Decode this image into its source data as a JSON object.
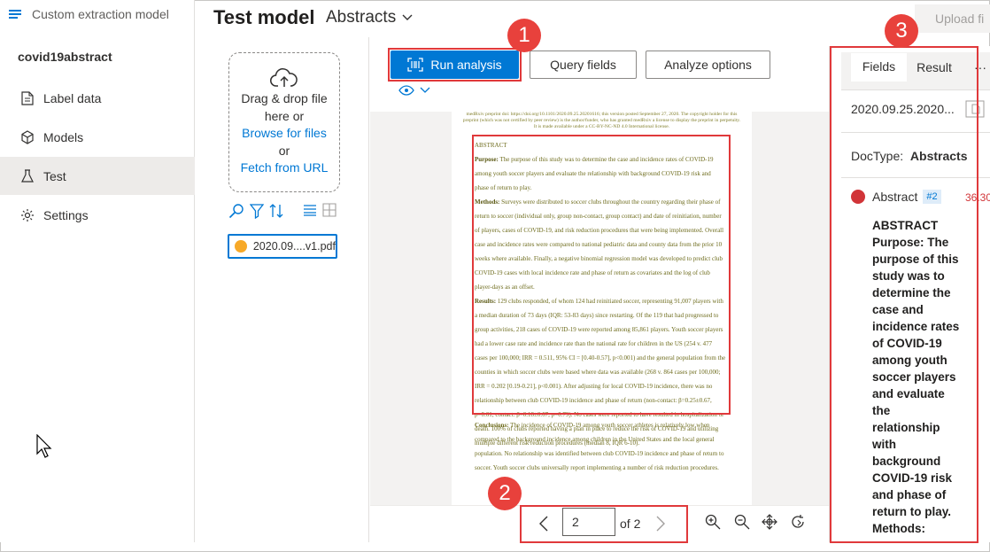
{
  "nav": {
    "app_title": "Custom extraction model",
    "project_name": "covid19abstract",
    "items": [
      {
        "label": "Label data",
        "icon": "document-icon"
      },
      {
        "label": "Models",
        "icon": "cube-icon"
      },
      {
        "label": "Test",
        "icon": "flask-icon"
      },
      {
        "label": "Settings",
        "icon": "gear-icon"
      }
    ]
  },
  "header": {
    "title": "Test model",
    "doc_type": "Abstracts",
    "upload_label": "Upload fi"
  },
  "files": {
    "drop_line1": "Drag & drop file",
    "drop_line2": "here or",
    "browse_link": "Browse for files",
    "or_text": "or",
    "fetch_link": "Fetch from URL",
    "file_name": "2020.09....v1.pdf"
  },
  "toolbar": {
    "run_label": "Run analysis",
    "query_label": "Query fields",
    "analyze_label": "Analyze options"
  },
  "document": {
    "header_line1": "medRxiv preprint doi: https://doi.org/10.1101/2020.09.25.20201616; this version posted September 27, 2020. The copyright holder for this",
    "header_line2": "preprint (which was not certified by peer review) is the author/funder, who has granted medRxiv a license to display the preprint in perpetuity.",
    "header_line3": "It is made available under a CC-BY-NC-ND 4.0 International license.",
    "heading": "ABSTRACT",
    "purpose_label": "Purpose:",
    "purpose_text": "The purpose of this study was to determine the case and incidence rates of COVID-19 among youth soccer players and evaluate the relationship with background COVID-19 risk and phase of return to play.",
    "methods_label": "Methods:",
    "methods_text": "Surveys were distributed to soccer clubs throughout the country regarding their phase of return to soccer (individual only, group non-contact, group contact) and date of reinitiation, number of players, cases of COVID-19, and risk reduction procedures that were being implemented. Overall case and incidence rates were compared to national pediatric data and county data from the prior 10 weeks where available. Finally, a negative binomial regression model was developed to predict club COVID-19 cases with local incidence rate and phase of return as covariates and the log of club player-days as an offset.",
    "results_label": "Results:",
    "results_text": "129 clubs responded, of whom 124 had reinitiated soccer, representing 91,007 players with a median duration of 73 days (IQR: 53-83 days) since restarting. Of the 119 that had progressed to group activities, 218 cases of COVID-19 were reported among 85,861 players. Youth soccer players had a lower case rate and incidence rate than the national rate for children in the US (254 v. 477 cases per 100,000; IRR = 0.511, 95% CI = [0.40-0.57], p<0.001) and the general population from the counties in which soccer clubs were based where data was available (268 v. 864 cases per 100,000; IRR = 0.202 [0.19-0.21], p<0.001). After adjusting for local COVID-19 incidence, there was no relationship between club COVID-19 incidence and phase of return (non-contact: β=0.25±0.67, p=0.61; contact: β=0.18±0.67, p=0.79). No cases were reported to have resulted in hospitalization or death. 100% of clubs reported having a plan in place to reduce the risk of COVID-19 and utilizing multiple different risk reduction procedures (median 8, IQR 6-10).",
    "conclusions_label": "Conclusions:",
    "conclusions_text": "The incidence of COVID-19 among youth soccer athletes is relatively low when compared to the background incidence among children in the United States and the local general population. No relationship was identified between club COVID-19 incidence and phase of return to soccer. Youth soccer clubs universally report implementing a number of risk reduction procedures."
  },
  "pager": {
    "current_page": "2",
    "total_label": "of 2"
  },
  "right_panel": {
    "tab_fields": "Fields",
    "tab_result": "Result",
    "more": "···",
    "file_name": "2020.09.25.2020...",
    "doctype_label": "DocType:",
    "doctype_value": "Abstracts",
    "field_name": "Abstract",
    "field_badge": "#2",
    "field_confidence": "36.30",
    "field_value": "ABSTRACT Purpose: The purpose of this study was to determine the case and incidence rates of COVID-19 among youth soccer players and evaluate the relationship with background COVID-19 risk and phase of return to play. Methods:"
  },
  "callouts": [
    "1",
    "2",
    "3"
  ],
  "colors": {
    "accent": "#0078d4",
    "callout": "#e8413c",
    "field_dot": "#d13438",
    "file_dot": "#f7a928"
  }
}
